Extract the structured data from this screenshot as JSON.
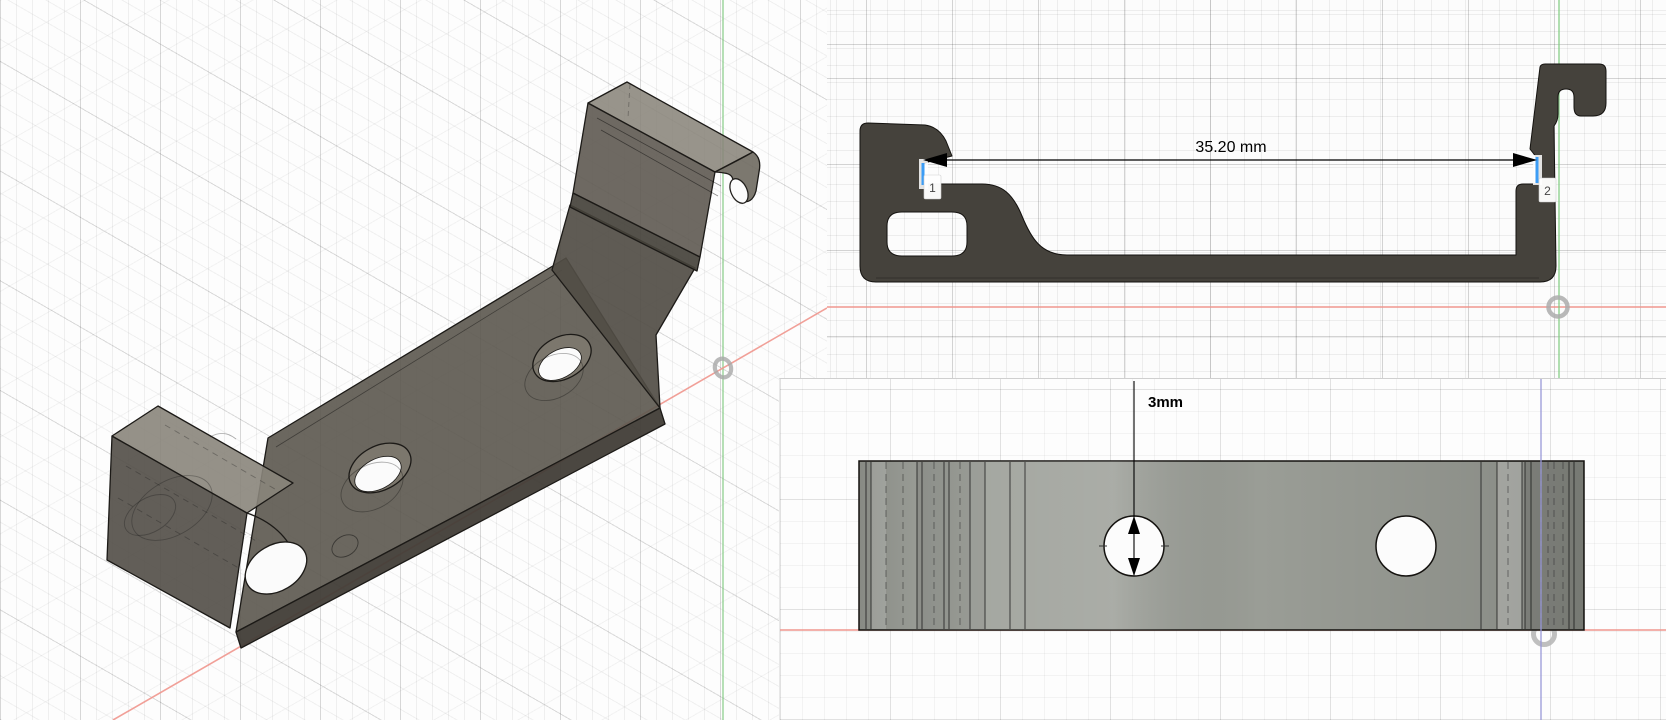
{
  "side_view": {
    "dimension_label": "35.20 mm",
    "marker_1": "1",
    "marker_2": "2"
  },
  "top_view": {
    "dimension_label": "3mm"
  },
  "colors": {
    "part_side_profile": "#45423c",
    "part_iso_face": "#5b564e",
    "part_iso_top": "#8a857b",
    "plate_top_view": "#9a9d96",
    "axis_red": "#f0968e",
    "axis_green": "#7fc97f",
    "axis_blue": "#9898d8",
    "edge_highlight_blue": "#3d9df5",
    "dimension_color": "#000000"
  }
}
